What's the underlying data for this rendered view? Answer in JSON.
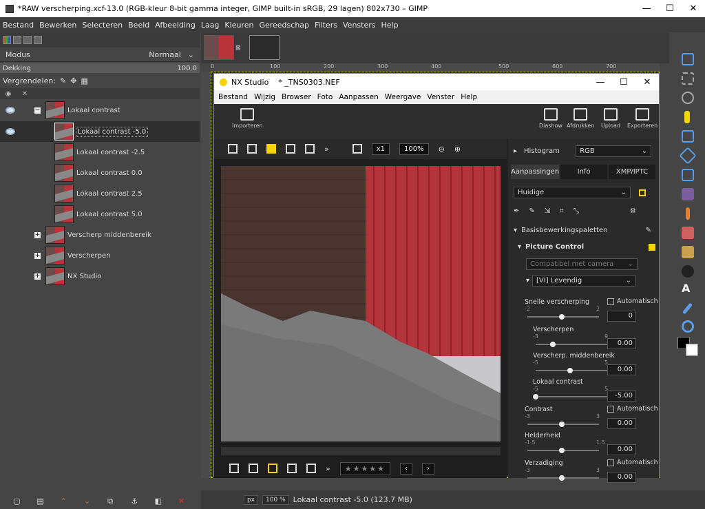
{
  "gimp": {
    "title": "*RAW verscherping.xcf-13.0 (RGB-kleur 8-bit gamma integer, GIMP built-in sRGB, 29 lagen) 802x730 – GIMP",
    "menu": [
      "Bestand",
      "Bewerken",
      "Selecteren",
      "Beeld",
      "Afbeelding",
      "Laag",
      "Kleuren",
      "Gereedschap",
      "Filters",
      "Vensters",
      "Help"
    ],
    "modus_label": "Modus",
    "modus_value": "Normaal",
    "dekking_label": "Dekking",
    "dekking_value": "100.0",
    "vergrendelen_label": "Vergrendelen:",
    "layers": [
      {
        "name": "Lokaal contrast"
      },
      {
        "name": "Lokaal contrast -5.0"
      },
      {
        "name": "Lokaal contrast -2.5"
      },
      {
        "name": "Lokaal contrast 0.0"
      },
      {
        "name": "Lokaal contrast 2.5"
      },
      {
        "name": "Lokaal contrast 5.0"
      },
      {
        "name": "Verscherp middenbereik"
      },
      {
        "name": "Verscherpen"
      },
      {
        "name": "NX Studio"
      }
    ],
    "ruler_ticks": [
      "0",
      "100",
      "200",
      "300",
      "400",
      "500",
      "600",
      "700"
    ],
    "status": {
      "unit": "px",
      "zoom": "100 %",
      "info": "Lokaal contrast -5.0 (123.7 MB)"
    }
  },
  "nx": {
    "title": "NX Studio",
    "file": "* _TNS0303.NEF",
    "menu": [
      "Bestand",
      "Wijzig",
      "Browser",
      "Foto",
      "Aanpassen",
      "Weergave",
      "Venster",
      "Help"
    ],
    "importeren": "Importeren",
    "toolbar": [
      "Diashow",
      "Afdrukken",
      "Upload",
      "Exporteren"
    ],
    "zoom_x1": "x1",
    "zoom_pct": "100%",
    "histogram_label": "Histogram",
    "histogram_mode": "RGB",
    "tabs": [
      "Aanpassingen",
      "Info",
      "XMP/IPTC"
    ],
    "preset": "Huidige",
    "basis": "Basisbewerkingspaletten",
    "picture_control": "Picture Control",
    "compat": "Compatibel met camera",
    "levendig": "[VI] Levendig",
    "sliders": [
      {
        "label": "Snelle verscherping",
        "min": "-2",
        "max": "2",
        "value": "0",
        "auto": "Automatisch",
        "knob": 0.5
      },
      {
        "label": "Verscherpen",
        "min": "-3",
        "max": "9",
        "value": "0.00",
        "knob": 0.25
      },
      {
        "label": "Verscherp. middenbereik",
        "min": "-5",
        "max": "5",
        "value": "0.00",
        "knob": 0.5
      },
      {
        "label": "Lokaal contrast",
        "min": "-5",
        "max": "5",
        "value": "-5.00",
        "knob": 0.0
      },
      {
        "label": "Contrast",
        "min": "-3",
        "max": "3",
        "value": "0.00",
        "auto": "Automatisch",
        "knob": 0.5
      },
      {
        "label": "Helderheid",
        "min": "-1.5",
        "max": "1.5",
        "value": "0.00",
        "knob": 0.5
      },
      {
        "label": "Verzadiging",
        "min": "-3",
        "max": "3",
        "value": "0.00",
        "auto": "Automatisch",
        "knob": 0.5
      }
    ]
  }
}
